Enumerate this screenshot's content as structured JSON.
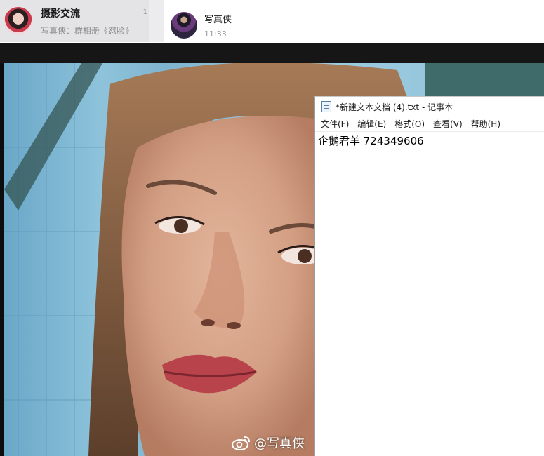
{
  "chat_list": {
    "item": {
      "title": "摄影交流",
      "preview": "写真侠：群相册《怼脸》",
      "count": "1"
    }
  },
  "chat_header": {
    "name": "写真侠",
    "time": "11:33"
  },
  "photo": {
    "watermark": "@写真侠"
  },
  "notepad": {
    "title": "*新建文本文档 (4).txt - 记事本",
    "menu": [
      "文件(F)",
      "编辑(E)",
      "格式(O)",
      "查看(V)",
      "帮助(H)"
    ],
    "content": "企鹅君羊 724349606"
  },
  "icons": {
    "chat_avatar": "avatar-woman",
    "header_avatar": "avatar-man",
    "watermark": "weibo-icon",
    "notepad": "text-file-icon"
  }
}
